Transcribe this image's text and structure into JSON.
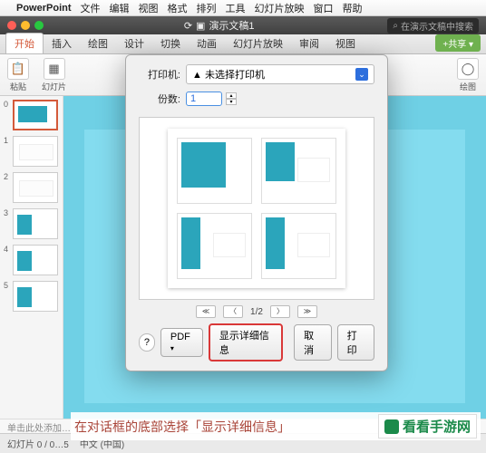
{
  "mac_menu": {
    "app": "PowerPoint",
    "items": [
      "文件",
      "编辑",
      "视图",
      "格式",
      "排列",
      "工具",
      "幻灯片放映",
      "窗口",
      "帮助"
    ]
  },
  "window": {
    "doc_title": "演示文稿1",
    "search_placeholder": "在演示文稿中搜索"
  },
  "ribbon": {
    "tabs": [
      "开始",
      "插入",
      "绘图",
      "设计",
      "切换",
      "动画",
      "幻灯片放映",
      "审阅",
      "视图"
    ],
    "share": "+共享 ▾",
    "paste_label": "粘贴",
    "slides_label": "幻灯片",
    "draw_label": "绘图"
  },
  "slides": {
    "count": 6
  },
  "print": {
    "printer_label": "打印机:",
    "printer_value": "▲ 未选择打印机",
    "copies_label": "份数:",
    "copies_value": "1",
    "page_indicator": "1/2",
    "help": "?",
    "pdf": "PDF",
    "details": "显示详细信息",
    "cancel": "取消",
    "ok": "打印",
    "nav": {
      "first": "≪",
      "prev": "〈",
      "next": "〉",
      "last": "≫"
    }
  },
  "notes": {
    "placeholder": "单击此处添加…"
  },
  "status": {
    "slide": "幻灯片 0 / 0…5",
    "lang": "中文 (中国)"
  },
  "annotation": {
    "text": "在对话框的底部选择「显示详细信息」",
    "brand": "看看手游网"
  }
}
